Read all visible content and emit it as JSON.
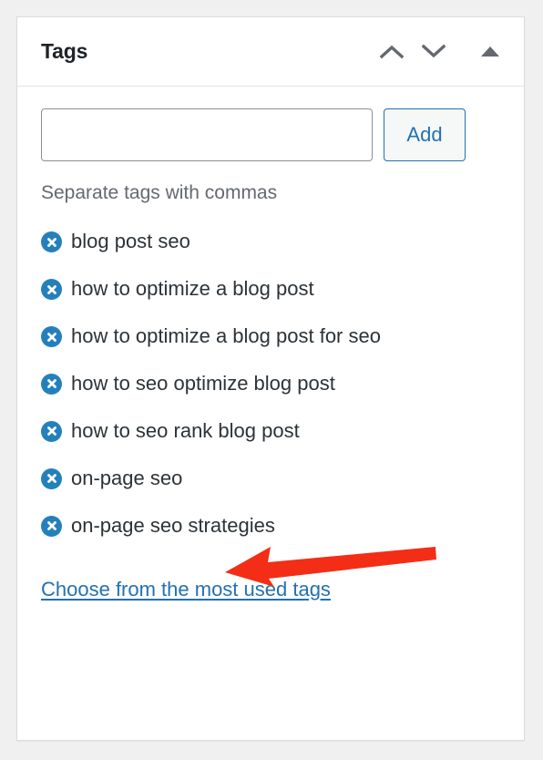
{
  "panel": {
    "title": "Tags",
    "header_actions": [
      {
        "name": "move-up-icon",
        "label": "Move up"
      },
      {
        "name": "move-down-icon",
        "label": "Move down"
      },
      {
        "name": "toggle-panel-icon",
        "label": "Toggle panel"
      }
    ]
  },
  "add_tag": {
    "input_value": "",
    "input_placeholder": "",
    "button_label": "Add",
    "help_text": "Separate tags with commas"
  },
  "tags": [
    {
      "label": "blog post seo",
      "remove_label": "Remove tag"
    },
    {
      "label": "how to optimize a blog post",
      "remove_label": "Remove tag"
    },
    {
      "label": "how to optimize a blog post for seo",
      "remove_label": "Remove tag"
    },
    {
      "label": "how to seo optimize blog post",
      "remove_label": "Remove tag"
    },
    {
      "label": "how to seo rank blog post",
      "remove_label": "Remove tag"
    },
    {
      "label": "on-page seo",
      "remove_label": "Remove tag"
    },
    {
      "label": "on-page seo strategies",
      "remove_label": "Remove tag"
    }
  ],
  "footer": {
    "most_used_link": "Choose from the most used tags"
  },
  "annotation": {
    "type": "arrow",
    "direction": "left",
    "points_at": "on-page seo",
    "color": "#f42d16"
  },
  "colors": {
    "page_background": "#f0f0f1",
    "panel_background": "#ffffff",
    "panel_border": "#dcdcde",
    "title_text": "#1d2327",
    "body_text": "#2c3338",
    "muted_text": "#646970",
    "accent_blue": "#2271b1",
    "remove_icon_blue": "#2480bd",
    "input_border": "#8c8f94",
    "annotation_red": "#f42d16"
  }
}
